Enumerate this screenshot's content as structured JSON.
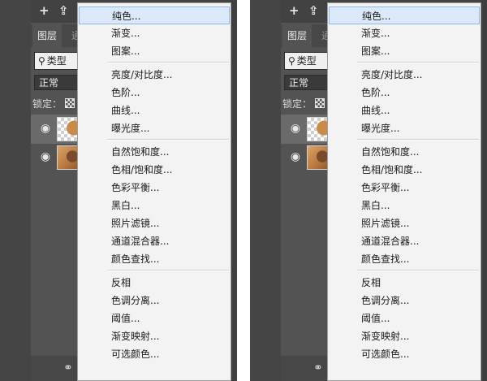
{
  "panel": {
    "tabs": [
      "图层",
      "通"
    ],
    "filter": {
      "icon": "search-icon",
      "label": "类型"
    },
    "blend_mode": "正常",
    "lock_label": "锁定：",
    "layers": [
      {
        "name": "",
        "thumbnail": "color-fill-adjustment"
      },
      {
        "name": "",
        "thumbnail": "photo-portrait"
      }
    ]
  },
  "menu": {
    "groups": [
      [
        "纯色..."
      ],
      [
        "亮度/对比度...",
        "色阶...",
        "曲线...",
        "曝光度..."
      ],
      [
        "自然饱和度...",
        "色相/饱和度...",
        "色彩平衡...",
        "黑白...",
        "照片滤镜...",
        "通道混合器...",
        "颜色查找..."
      ],
      [
        "反相",
        "色调分离...",
        "阈值...",
        "渐变映射...",
        "可选颜色..."
      ]
    ],
    "items": [
      "纯色...",
      "渐变...",
      "图案...",
      "亮度/对比度...",
      "色阶...",
      "曲线...",
      "曝光度...",
      "自然饱和度...",
      "色相/饱和度...",
      "色彩平衡...",
      "黑白...",
      "照片滤镜...",
      "通道混合器...",
      "颜色查找...",
      "反相",
      "色调分离...",
      "阈值...",
      "渐变映射...",
      "可选颜色..."
    ],
    "highlighted": "纯色..."
  },
  "colors": {
    "panel_bg": "#535353",
    "menu_bg": "#f3f3f3",
    "highlight_bg": "#dbe9fb",
    "highlight_border": "#8fb6e9"
  }
}
